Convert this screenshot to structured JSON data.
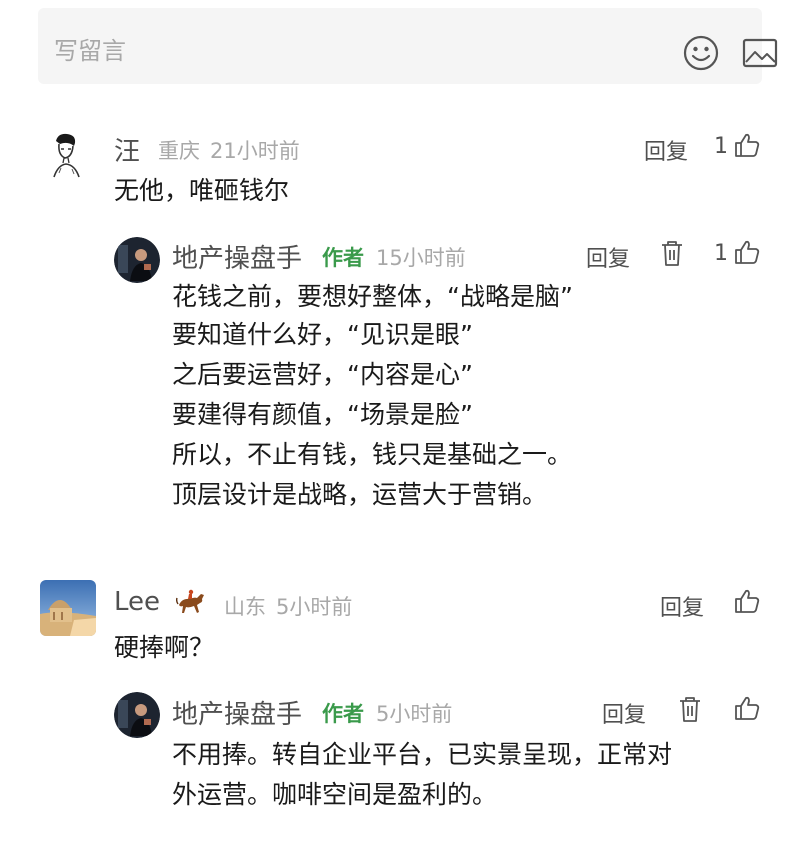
{
  "compose": {
    "placeholder": "写留言",
    "emoji_icon": "emoji-smile-icon",
    "image_icon": "image-icon"
  },
  "comments": [
    {
      "user": "汪",
      "location": "重庆",
      "time": "21小时前",
      "text": "无他，唯砸钱尔",
      "reply_label": "回复",
      "likes": "1",
      "reply": {
        "user": "地产操盘手",
        "author_tag": "作者",
        "time": "15小时前",
        "reply_label": "回复",
        "likes": "1",
        "lines": [
          "花钱之前，要想好整体，“战略是脑”",
          "要知道什么好，“见识是眼”",
          "之后要运营好，“内容是心”",
          "要建得有颜值，“场景是脸”",
          "所以，不止有钱，钱只是基础之一。",
          "顶层设计是战略，运营大于营销。"
        ]
      }
    },
    {
      "user": "Lee",
      "location": "山东",
      "time": "5小时前",
      "text": "硬捧啊？",
      "reply_label": "回复",
      "likes": "",
      "reply": {
        "user": "地产操盘手",
        "author_tag": "作者",
        "time": "5小时前",
        "reply_label": "回复",
        "likes": "",
        "lines": [
          "不用捧。转自企业平台，已实景呈现，正常对",
          "外运营。咖啡空间是盈利的。"
        ]
      }
    }
  ],
  "colors": {
    "author_green": "#3a9a4b",
    "meta_gray": "#a8a8a8",
    "compose_bg": "#f5f5f5"
  }
}
